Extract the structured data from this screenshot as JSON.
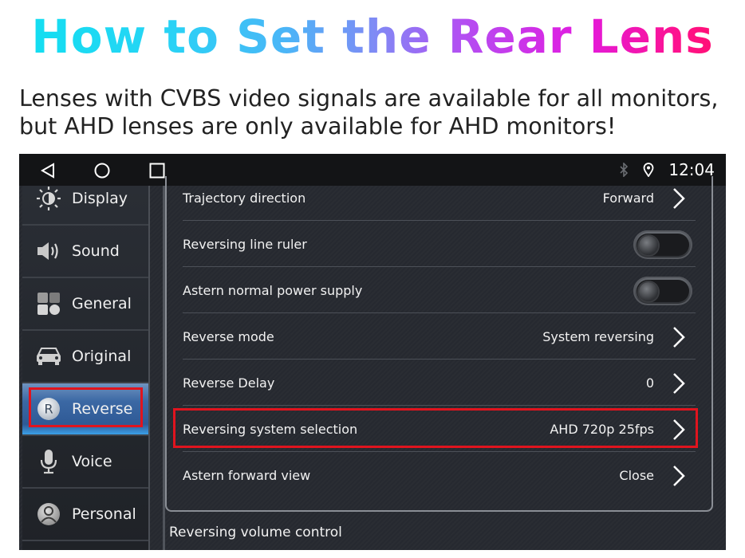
{
  "header": {
    "title": "How to Set the Rear Lens",
    "subtitle_line1": "Lenses with CVBS video signals are available for all monitors,",
    "subtitle_line2": "but AHD lenses are only available for AHD monitors!"
  },
  "statusbar": {
    "nav": [
      {
        "icon": "back-icon"
      },
      {
        "icon": "home-icon"
      },
      {
        "icon": "recents-icon"
      }
    ],
    "bluetooth_icon": "bluetooth-icon",
    "location_icon": "location-icon",
    "time": "12:04"
  },
  "sidebar": {
    "items": [
      {
        "label": "Display",
        "icon": "brightness-icon",
        "active": false
      },
      {
        "label": "Sound",
        "icon": "speaker-icon",
        "active": false
      },
      {
        "label": "General",
        "icon": "grid-icon",
        "active": false
      },
      {
        "label": "Original",
        "icon": "car-icon",
        "active": false
      },
      {
        "label": "Reverse",
        "icon": "reverse-r-icon",
        "active": true
      },
      {
        "label": "Voice",
        "icon": "microphone-icon",
        "active": false
      },
      {
        "label": "Personal",
        "icon": "user-icon",
        "active": false
      }
    ]
  },
  "settings": {
    "rows": [
      {
        "label": "Trajectory direction",
        "value": "Forward",
        "type": "chevron"
      },
      {
        "label": "Reversing line ruler",
        "value": "",
        "type": "toggle",
        "on": false
      },
      {
        "label": "Astern normal power supply",
        "value": "",
        "type": "toggle",
        "on": false
      },
      {
        "label": "Reverse mode",
        "value": "System reversing",
        "type": "chevron"
      },
      {
        "label": "Reverse Delay",
        "value": "0",
        "type": "chevron"
      },
      {
        "label": "Reversing system selection",
        "value": "AHD 720p 25fps",
        "type": "chevron",
        "highlighted": true
      },
      {
        "label": "Astern forward view",
        "value": "Close",
        "type": "chevron"
      }
    ],
    "next_section_label": "Reversing volume control"
  },
  "colors": {
    "highlight_box": "#e0141e",
    "active_tab": "#2f5a96"
  }
}
